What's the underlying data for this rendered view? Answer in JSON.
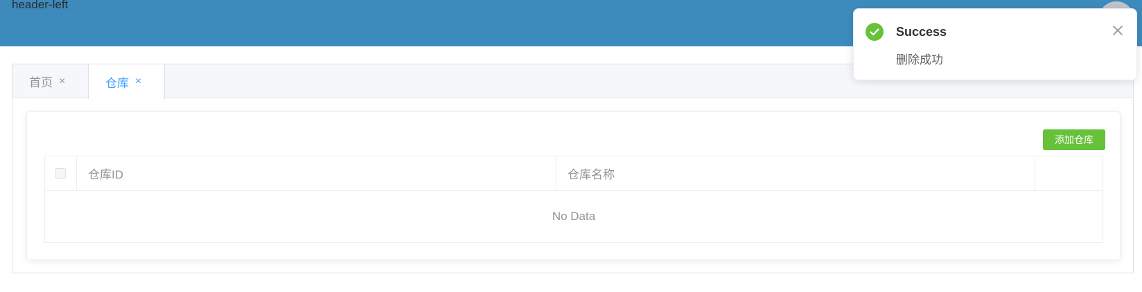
{
  "header": {
    "left_text": "header-left"
  },
  "tabs": [
    {
      "label": "首页",
      "close": "×"
    },
    {
      "label": "仓库",
      "close": "×"
    }
  ],
  "toolbar": {
    "add_label": "添加仓库"
  },
  "table": {
    "columns": [
      "仓库ID",
      "仓库名称",
      ""
    ],
    "empty_text": "No Data"
  },
  "notification": {
    "title": "Success",
    "message": "删除成功",
    "icon": "check-circle-icon"
  },
  "colors": {
    "header": "#3d8bbd",
    "primary": "#409eff",
    "success": "#67c23a"
  }
}
